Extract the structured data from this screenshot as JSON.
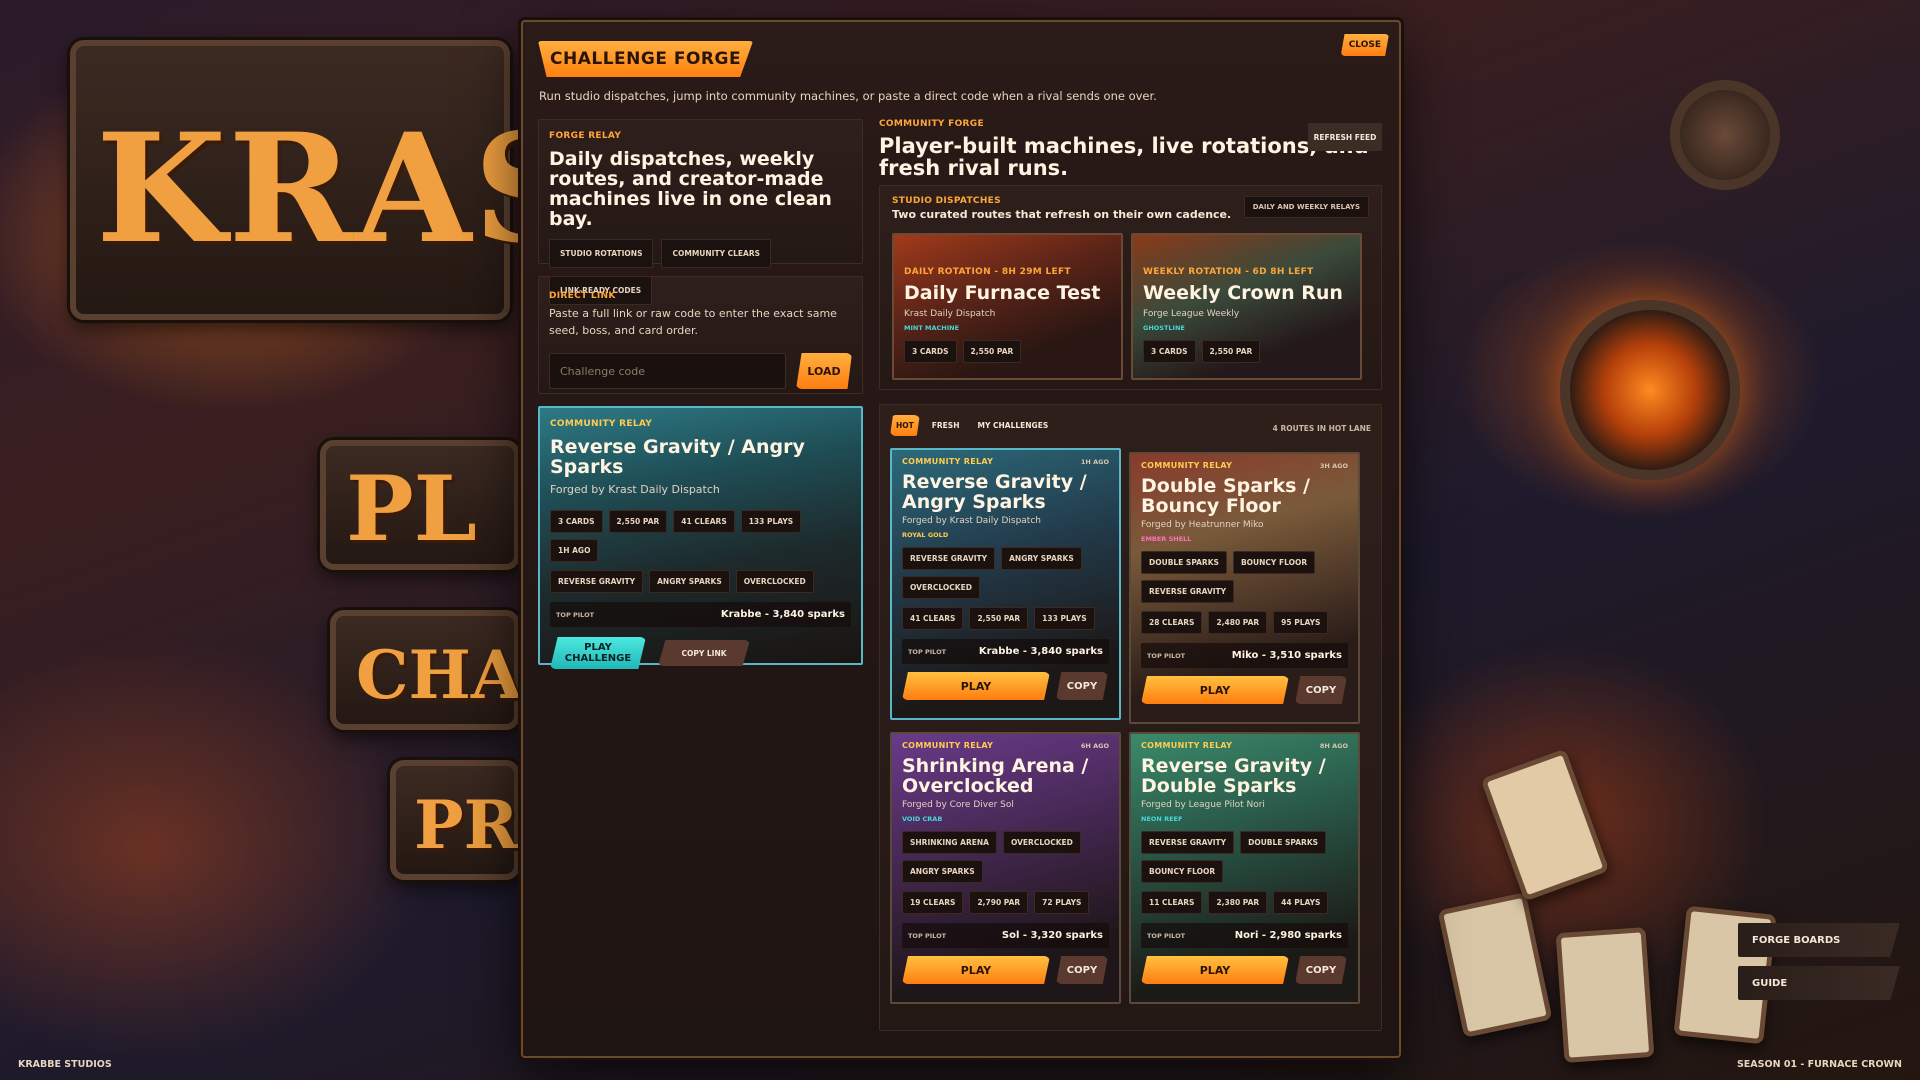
{
  "background": {
    "logo_text": "KRAS",
    "sign_play": "PL",
    "sign_challenge": "CHAL",
    "sign_profile": "PRO"
  },
  "header": {
    "title": "CHALLENGE FORGE",
    "close_label": "CLOSE",
    "subtitle": "Run studio dispatches, jump into community machines, or paste a direct code when a rival sends one over."
  },
  "forge_relay": {
    "kicker": "FORGE RELAY",
    "heading": "Daily dispatches, weekly routes, and creator-made machines live in one clean bay.",
    "chips": [
      "STUDIO ROTATIONS",
      "COMMUNITY CLEARS",
      "LINK-READY CODES"
    ]
  },
  "direct_link": {
    "kicker": "DIRECT LINK",
    "description": "Paste a full link or raw code to enter the exact same seed, boss, and card order.",
    "placeholder": "Challenge code",
    "load_label": "LOAD"
  },
  "featured": {
    "kicker": "COMMUNITY RELAY",
    "title": "Reverse Gravity / Angry Sparks",
    "forged_by": "Forged by Krast Daily Dispatch",
    "stats": [
      "3 CARDS",
      "2,550 PAR",
      "41 CLEARS",
      "133 PLAYS",
      "1H AGO"
    ],
    "mods": [
      "REVERSE GRAVITY",
      "ANGRY SPARKS",
      "OVERCLOCKED"
    ],
    "pilot_label": "TOP PILOT",
    "pilot_value": "Krabbe - 3,840 sparks",
    "play_label": "PLAY CHALLENGE",
    "copy_label": "COPY LINK"
  },
  "community": {
    "kicker": "COMMUNITY FORGE",
    "heading": "Player-built machines, live rotations, and fresh rival runs.",
    "refresh_label": "REFRESH FEED"
  },
  "dispatches": {
    "kicker": "STUDIO DISPATCHES",
    "subtitle": "Two curated routes that refresh on their own cadence.",
    "pill": "DAILY AND WEEKLY RELAYS",
    "cards": [
      {
        "kicker": "DAILY ROTATION - 8H 29M LEFT",
        "title": "Daily Furnace Test",
        "by": "Krast Daily Dispatch",
        "tag": "MINT MACHINE",
        "chips": [
          "3 CARDS",
          "2,550 PAR"
        ]
      },
      {
        "kicker": "WEEKLY ROTATION - 6D 8H LEFT",
        "title": "Weekly Crown Run",
        "by": "Forge League Weekly",
        "tag": "GHOSTLINE",
        "chips": [
          "3 CARDS",
          "2,550 PAR"
        ]
      }
    ]
  },
  "hot_lane": {
    "filters": [
      "HOT",
      "FRESH",
      "MY CHALLENGES"
    ],
    "routes_count": "4 ROUTES IN HOT LANE",
    "cards": [
      {
        "kicker": "COMMUNITY RELAY",
        "time": "1H AGO",
        "title": "Reverse Gravity / Angry Sparks",
        "by": "Forged by Krast Daily Dispatch",
        "tag": "ROYAL GOLD",
        "mods": [
          "REVERSE GRAVITY",
          "ANGRY SPARKS",
          "OVERCLOCKED"
        ],
        "stats": [
          "41 CLEARS",
          "2,550 PAR",
          "133 PLAYS"
        ],
        "pilot_label": "TOP PILOT",
        "pilot": "Krabbe - 3,840 sparks",
        "play": "PLAY",
        "copy": "COPY"
      },
      {
        "kicker": "COMMUNITY RELAY",
        "time": "3H AGO",
        "title": "Double Sparks / Bouncy Floor",
        "by": "Forged by Heatrunner Miko",
        "tag": "EMBER SHELL",
        "mods": [
          "DOUBLE SPARKS",
          "BOUNCY FLOOR",
          "REVERSE GRAVITY"
        ],
        "stats": [
          "28 CLEARS",
          "2,480 PAR",
          "95 PLAYS"
        ],
        "pilot_label": "TOP PILOT",
        "pilot": "Miko - 3,510 sparks",
        "play": "PLAY",
        "copy": "COPY"
      },
      {
        "kicker": "COMMUNITY RELAY",
        "time": "6H AGO",
        "title": "Shrinking Arena / Overclocked",
        "by": "Forged by Core Diver Sol",
        "tag": "VOID CRAB",
        "mods": [
          "SHRINKING ARENA",
          "OVERCLOCKED",
          "ANGRY SPARKS"
        ],
        "stats": [
          "19 CLEARS",
          "2,790 PAR",
          "72 PLAYS"
        ],
        "pilot_label": "TOP PILOT",
        "pilot": "Sol - 3,320 sparks",
        "play": "PLAY",
        "copy": "COPY"
      },
      {
        "kicker": "COMMUNITY RELAY",
        "time": "8H AGO",
        "title": "Reverse Gravity / Double Sparks",
        "by": "Forged by League Pilot Nori",
        "tag": "NEON REEF",
        "mods": [
          "REVERSE GRAVITY",
          "DOUBLE SPARKS",
          "BOUNCY FLOOR"
        ],
        "stats": [
          "11 CLEARS",
          "2,380 PAR",
          "44 PLAYS"
        ],
        "pilot_label": "TOP PILOT",
        "pilot": "Nori - 2,980 sparks",
        "play": "PLAY",
        "copy": "COPY"
      }
    ]
  },
  "side_menu": {
    "forge_boards": "FORGE BOARDS",
    "guide": "GUIDE"
  },
  "footer": {
    "studio": "KRABBE STUDIOS",
    "season": "SEASON 01 - FURNACE CROWN"
  }
}
